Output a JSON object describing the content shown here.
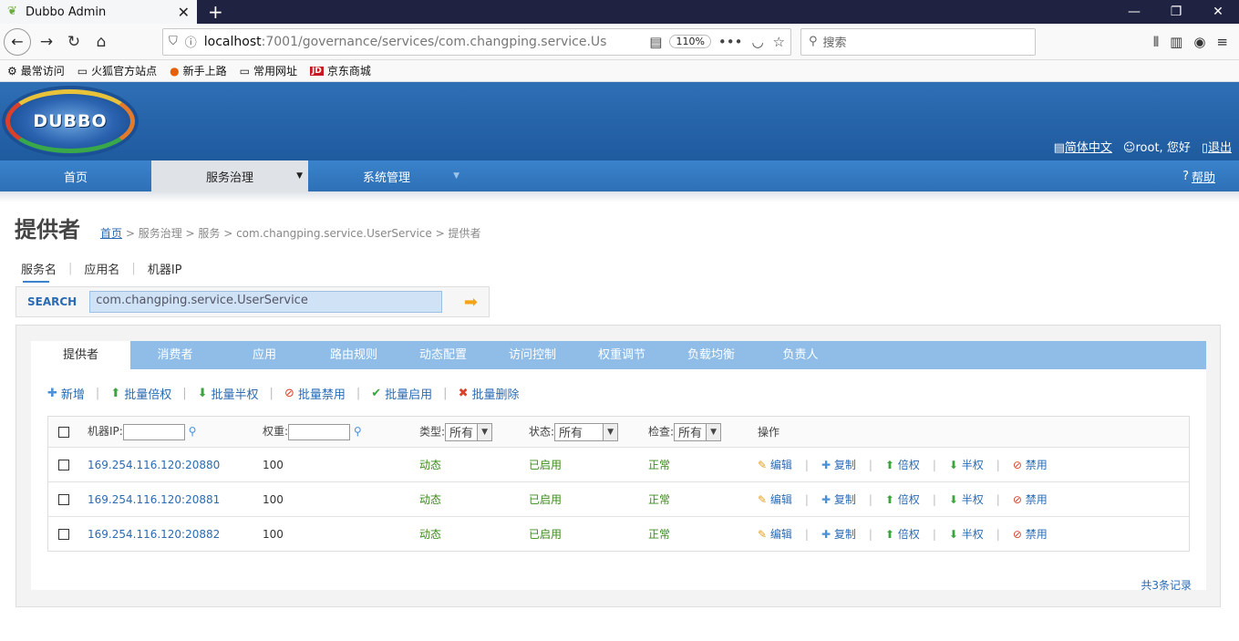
{
  "browser": {
    "tab_title": "Dubbo Admin",
    "url_host": "localhost",
    "url_rest": ":7001/governance/services/com.changping.service.Us",
    "zoom": "110%",
    "search_placeholder": "搜索",
    "bookmarks": [
      "最常访问",
      "火狐官方站点",
      "新手上路",
      "常用网址",
      "京东商城"
    ]
  },
  "header": {
    "logo_text": "DUBBO",
    "lang": "简体中文",
    "user": "root, 您好",
    "logout": "退出"
  },
  "menu": {
    "home": "首页",
    "service_gov": "服务治理",
    "sys_mgmt": "系统管理",
    "help": "帮助"
  },
  "page": {
    "title": "提供者",
    "crumb_home": "首页",
    "crumb_rest": " > 服务治理 > 服务 > com.changping.service.UserService > 提供者"
  },
  "subtabs": [
    "服务名",
    "应用名",
    "机器IP"
  ],
  "search": {
    "label": "SEARCH",
    "value": "com.changping.service.UserService"
  },
  "tabs": [
    "提供者",
    "消费者",
    "应用",
    "路由规则",
    "动态配置",
    "访问控制",
    "权重调节",
    "负载均衡",
    "负责人"
  ],
  "actions": {
    "add": "新增",
    "double": "批量倍权",
    "half": "批量半权",
    "disable": "批量禁用",
    "enable": "批量启用",
    "delete": "批量删除"
  },
  "table": {
    "col_ip": "机器IP:",
    "col_weight": "权重:",
    "col_type": "类型:",
    "col_status": "状态:",
    "col_check": "检查:",
    "col_ops": "操作",
    "filter_all": "所有",
    "rows": [
      {
        "ip": "169.254.116.120:20880",
        "weight": "100",
        "type": "动态",
        "status": "已启用",
        "check": "正常"
      },
      {
        "ip": "169.254.116.120:20881",
        "weight": "100",
        "type": "动态",
        "status": "已启用",
        "check": "正常"
      },
      {
        "ip": "169.254.116.120:20882",
        "weight": "100",
        "type": "动态",
        "status": "已启用",
        "check": "正常"
      }
    ],
    "ops": {
      "edit": "编辑",
      "copy": "复制",
      "double": "倍权",
      "half": "半权",
      "disable": "禁用"
    },
    "total": "共3条记录"
  }
}
